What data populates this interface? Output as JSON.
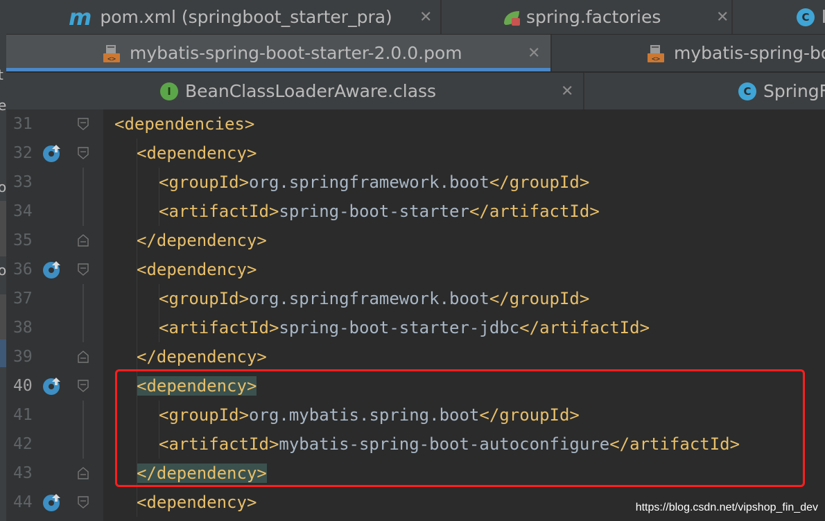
{
  "tabs": {
    "row1": [
      {
        "label": "pom.xml (springboot_starter_pra)",
        "icon": "maven-m-icon"
      },
      {
        "label": "spring.factories",
        "icon": "spring-leaf-icon"
      },
      {
        "label": "l",
        "icon": "class-c-icon"
      }
    ],
    "row2": [
      {
        "label": "mybatis-spring-boot-starter-2.0.0.pom",
        "icon": "pom-file-icon",
        "active": true
      },
      {
        "label": "mybatis-spring-boo",
        "icon": "pom-file-icon"
      }
    ],
    "row3": [
      {
        "label": "BeanClassLoaderAware.class",
        "icon": "interface-i-icon"
      },
      {
        "label": "SpringF",
        "icon": "class-c-icon"
      }
    ]
  },
  "left_strip": {
    "glyphs": [
      "t",
      "e",
      "o",
      "o"
    ]
  },
  "editor": {
    "lines": [
      {
        "num": "31",
        "indent": 0,
        "open": "<dependencies>",
        "text": "",
        "close": ""
      },
      {
        "num": "32",
        "indent": 1,
        "open": "<dependency>",
        "text": "",
        "close": ""
      },
      {
        "num": "33",
        "indent": 2,
        "open": "<groupId>",
        "text": "org.springframework.boot",
        "close": "</groupId>"
      },
      {
        "num": "34",
        "indent": 2,
        "open": "<artifactId>",
        "text": "spring-boot-starter",
        "close": "</artifactId>"
      },
      {
        "num": "35",
        "indent": 1,
        "open": "</dependency>",
        "text": "",
        "close": ""
      },
      {
        "num": "36",
        "indent": 1,
        "open": "<dependency>",
        "text": "",
        "close": ""
      },
      {
        "num": "37",
        "indent": 2,
        "open": "<groupId>",
        "text": "org.springframework.boot",
        "close": "</groupId>"
      },
      {
        "num": "38",
        "indent": 2,
        "open": "<artifactId>",
        "text": "spring-boot-starter-jdbc",
        "close": "</artifactId>"
      },
      {
        "num": "39",
        "indent": 1,
        "open": "</dependency>",
        "text": "",
        "close": ""
      },
      {
        "num": "40",
        "indent": 1,
        "open": "<dependency>",
        "text": "",
        "close": ""
      },
      {
        "num": "41",
        "indent": 2,
        "open": "<groupId>",
        "text": "org.mybatis.spring.boot",
        "close": "</groupId>"
      },
      {
        "num": "42",
        "indent": 2,
        "open": "<artifactId>",
        "text": "mybatis-spring-boot-autoconfigure",
        "close": "</artifactId>"
      },
      {
        "num": "43",
        "indent": 1,
        "open": "</dependency>",
        "text": "",
        "close": ""
      },
      {
        "num": "44",
        "indent": 1,
        "open": "<dependency>",
        "text": "",
        "close": ""
      }
    ]
  },
  "watermark": "https://blog.csdn.net/vipshop_fin_dev",
  "colors": {
    "tag": "#e8bf6a",
    "text": "#a9b7c6",
    "highlight": "#3b514d",
    "red_box": "#ff1e1e",
    "accent": "#4a88c7"
  }
}
